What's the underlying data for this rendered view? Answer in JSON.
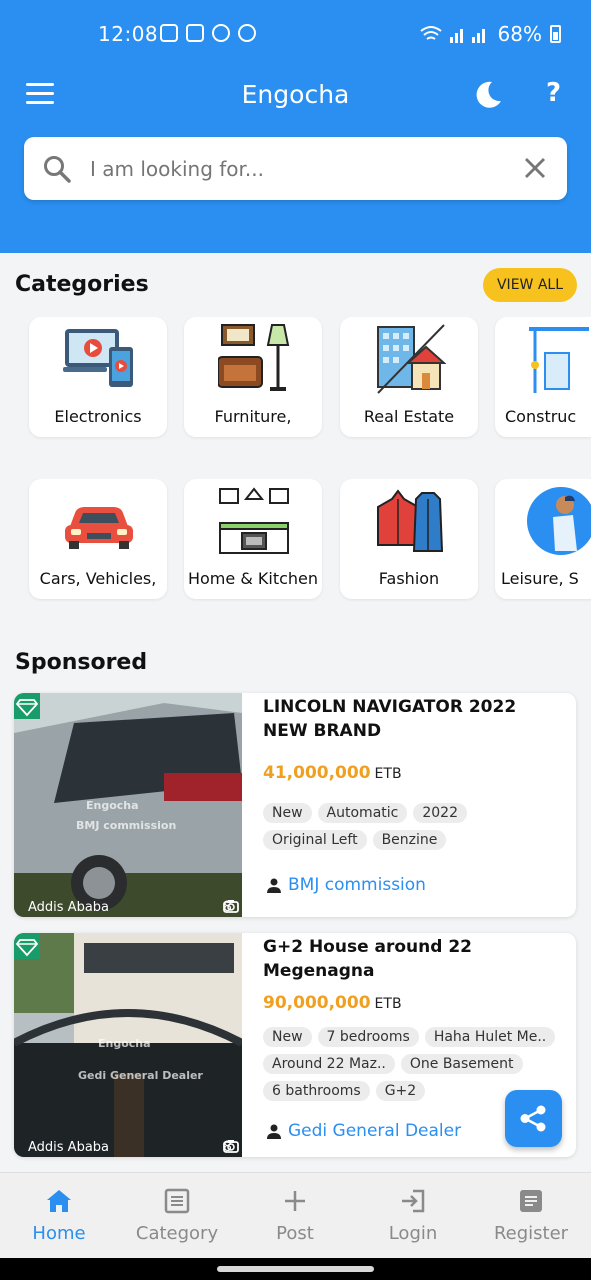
{
  "status_bar": {
    "time": "12:08",
    "battery": "68%"
  },
  "app": {
    "title": "Engocha"
  },
  "search": {
    "placeholder": "I am looking for..."
  },
  "categories": {
    "title": "Categories",
    "view_all": "VIEW ALL",
    "row1": [
      {
        "label": "Electronics",
        "icon": "electronics-icon"
      },
      {
        "label": "Furniture,",
        "icon": "furniture-icon"
      },
      {
        "label": "Real Estate",
        "icon": "real-estate-icon"
      },
      {
        "label": "Construc",
        "icon": "construction-icon"
      }
    ],
    "row2": [
      {
        "label": "Cars, Vehicles,",
        "icon": "car-icon"
      },
      {
        "label": "Home & Kitchen",
        "icon": "kitchen-icon"
      },
      {
        "label": "Fashion",
        "icon": "fashion-icon"
      },
      {
        "label": "Leisure, S",
        "icon": "leisure-icon"
      }
    ]
  },
  "sponsored": {
    "title": "Sponsored",
    "listings": [
      {
        "title": "LINCOLN NAVIGATOR 2022 NEW BRAND",
        "price": "41,000,000",
        "currency": "ETB",
        "location": "Addis Ababa",
        "photo_count": "8",
        "watermark_brand": "Engocha",
        "watermark_seller": "BMJ commission",
        "chips": [
          "New",
          "Automatic",
          "2022",
          "Original Left",
          "Benzine"
        ],
        "seller": "BMJ commission"
      },
      {
        "title": "G+2 House around 22 Megenagna",
        "price": "90,000,000",
        "currency": "ETB",
        "location": "Addis Ababa",
        "photo_count": "8",
        "watermark_brand": "Engocha",
        "watermark_seller": "Gedi General Dealer",
        "chips": [
          "New",
          "7 bedrooms",
          "Haha Hulet Me..",
          "Around 22 Maz..",
          "One Basement",
          "6 bathrooms",
          "G+2"
        ],
        "seller": "Gedi General Dealer"
      }
    ]
  },
  "bottom_nav": {
    "items": [
      {
        "label": "Home",
        "icon": "home-icon",
        "active": true
      },
      {
        "label": "Category",
        "icon": "category-icon",
        "active": false
      },
      {
        "label": "Post",
        "icon": "plus-icon",
        "active": false
      },
      {
        "label": "Login",
        "icon": "login-icon",
        "active": false
      },
      {
        "label": "Register",
        "icon": "register-icon",
        "active": false
      }
    ]
  },
  "colors": {
    "primary": "#2a8ff0",
    "accent": "#f7c21d",
    "price": "#f0a021"
  }
}
